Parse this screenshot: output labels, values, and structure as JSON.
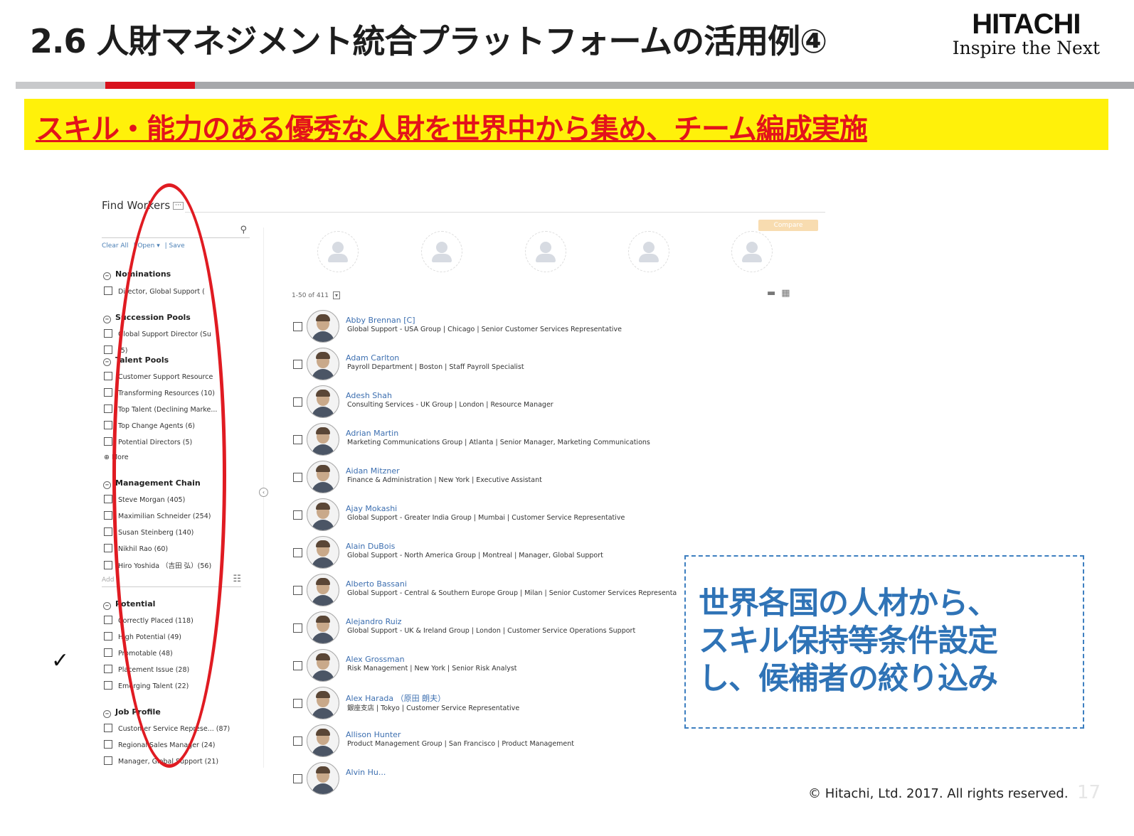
{
  "header": {
    "title": "2.6 人財マネジメント統合プラットフォームの活用例④",
    "logo_brand": "HITACHI",
    "logo_tagline": "Inspire the Next"
  },
  "banner": {
    "text": "スキル・能力のある優秀な人財を世界中から集め、チーム編成実施"
  },
  "colors": {
    "banner_bg": "#fff10a",
    "banner_text": "#e3131b",
    "accent_red": "#d8111c",
    "callout_blue": "#2f73b6",
    "link_blue": "#3d6fb0"
  },
  "find_workers": {
    "title": "Find Workers",
    "menu_icon": "ellipsis-icon",
    "search_icon": "search-icon",
    "actions": {
      "clear_all": "Clear All",
      "open": "| Open ▾",
      "save": "| Save"
    },
    "sections": [
      {
        "title": "Nominations",
        "items": [
          "Director, Global Support ("
        ]
      },
      {
        "title": "Succession Pools",
        "items": [
          "Global Support Director (Su",
          "(5)"
        ]
      },
      {
        "title": "Talent Pools",
        "items": [
          "Customer Support Resource",
          "Transforming Resources (10)",
          "Top Talent (Declining Marke...",
          "Top Change Agents (6)",
          "Potential Directors (5)"
        ],
        "more": "More"
      },
      {
        "title": "Management Chain",
        "items": [
          "Steve Morgan (405)",
          "Maximilian Schneider (254)",
          "Susan Steinberg (140)",
          "Nikhil Rao (60)",
          "Hiro Yoshida （吉田 弘）(56)"
        ],
        "input_placeholder": "Add"
      },
      {
        "title": "Potential",
        "items": [
          "Correctly Placed (118)",
          "High Potential (49)",
          "Promotable (48)",
          "Placement Issue (28)",
          "Emerging Talent (22)"
        ]
      },
      {
        "title": "Job Profile",
        "items": [
          "Customer Service Represe... (87)",
          "Regional Sales Manager (24)",
          "Manager, Global Support (21)"
        ]
      }
    ]
  },
  "compare_button": "Compare",
  "pager": {
    "text": "1-50 of 411",
    "dropdown": "▾"
  },
  "workers": [
    {
      "name": "Abby Brennan [C]",
      "detail": "Global Support - USA Group | Chicago | Senior Customer Services Representative"
    },
    {
      "name": "Adam Carlton",
      "detail": "Payroll Department | Boston | Staff Payroll Specialist"
    },
    {
      "name": "Adesh Shah",
      "detail": "Consulting Services - UK Group | London | Resource Manager"
    },
    {
      "name": "Adrian Martin",
      "detail": "Marketing Communications Group | Atlanta | Senior Manager, Marketing Communications"
    },
    {
      "name": "Aidan Mitzner",
      "detail": "Finance & Administration | New York | Executive Assistant"
    },
    {
      "name": "Ajay Mokashi",
      "detail": "Global Support - Greater India Group | Mumbai | Customer Service Representative"
    },
    {
      "name": "Alain DuBois",
      "detail": "Global Support - North America Group | Montreal | Manager, Global Support"
    },
    {
      "name": "Alberto Bassani",
      "detail": "Global Support - Central & Southern Europe Group | Milan | Senior Customer Services Representa"
    },
    {
      "name": "Alejandro Ruiz",
      "detail": "Global Support - UK & Ireland Group | London | Customer Service Operations Support"
    },
    {
      "name": "Alex Grossman",
      "detail": "Risk Management | New York | Senior Risk Analyst"
    },
    {
      "name": "Alex Harada （原田 朗夫）",
      "detail": "銀座支店 | Tokyo | Customer Service Representative"
    },
    {
      "name": "Allison Hunter",
      "detail": "Product Management Group | San Francisco | Product Management"
    },
    {
      "name": "Alvin Hu...",
      "detail": ""
    }
  ],
  "callout": {
    "lines": [
      "世界各国の人材から、",
      "スキル保持等条件設定",
      "し、候補者の絞り込み"
    ]
  },
  "annotation": {
    "checkmark": "✓"
  },
  "footer": {
    "copyright": "© Hitachi, Ltd. 2017. All rights reserved.",
    "page": "17"
  }
}
